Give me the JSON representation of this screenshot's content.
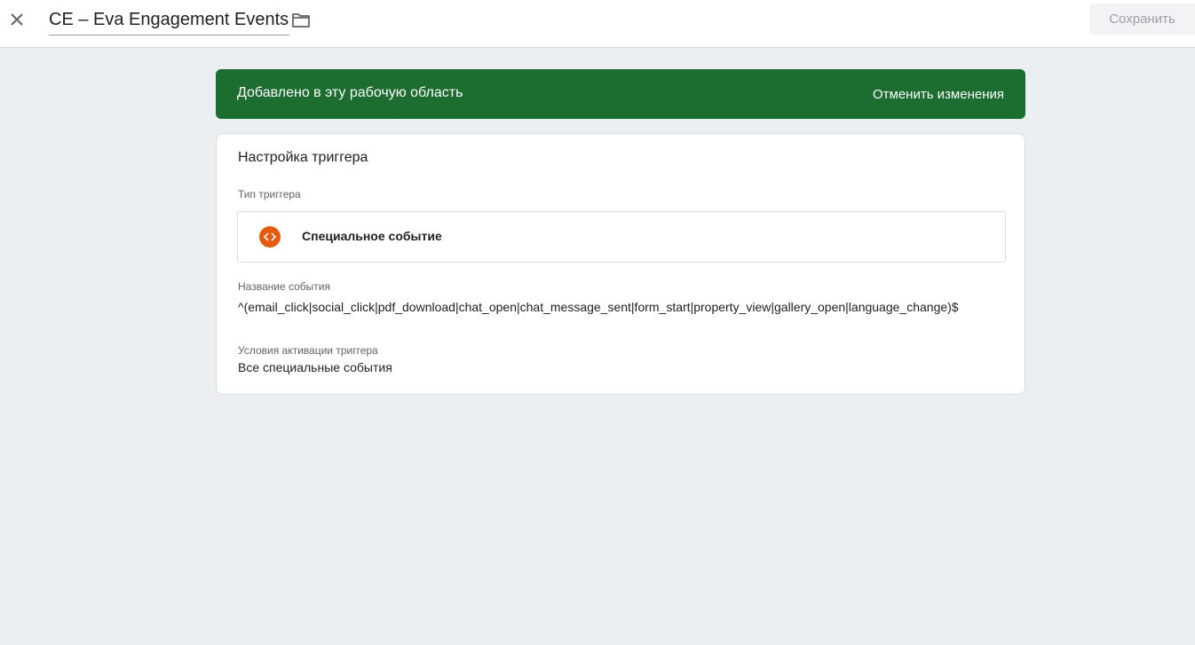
{
  "header": {
    "title": "CE – Eva Engagement Events",
    "save_label": "Сохранить"
  },
  "banner": {
    "message": "Добавлено в эту рабочую область",
    "undo_label": "Отменить изменения",
    "color": "#1b6e30"
  },
  "trigger_config": {
    "title": "Настройка триггера",
    "type_label": "Тип триггера",
    "type_name": "Специальное событие",
    "type_icon": "code-brackets-icon",
    "type_icon_color": "#e8590c",
    "event_name_label": "Название события",
    "event_name_value": "^(email_click|social_click|pdf_download|chat_open|chat_message_sent|form_start|property_view|gallery_open|language_change)$",
    "conditions_label": "Условия активации триггера",
    "conditions_value": "Все специальные события"
  }
}
